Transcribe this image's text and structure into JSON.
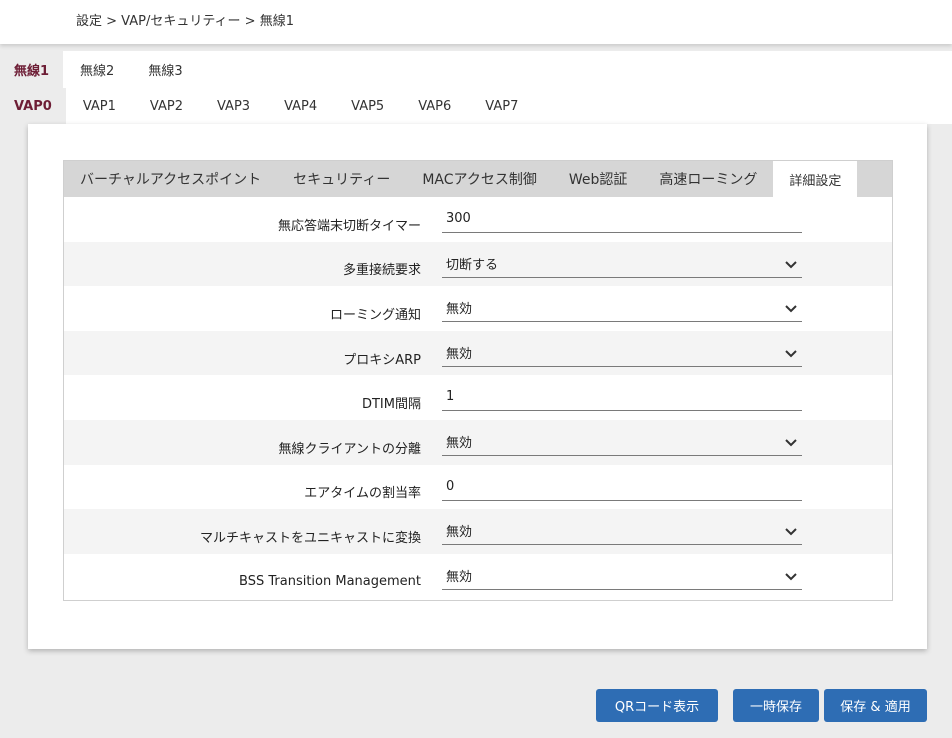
{
  "breadcrumb": "設定 > VAP/セキュリティー > 無線1",
  "radio_tabs": [
    "無線1",
    "無線2",
    "無線3"
  ],
  "radio_active": 0,
  "vap_tabs": [
    "VAP0",
    "VAP1",
    "VAP2",
    "VAP3",
    "VAP4",
    "VAP5",
    "VAP6",
    "VAP7"
  ],
  "vap_active": 0,
  "sub_tabs": [
    "バーチャルアクセスポイント",
    "セキュリティー",
    "MACアクセス制御",
    "Web認証",
    "高速ローミング",
    "詳細設定"
  ],
  "sub_active": 5,
  "rows": [
    {
      "label": "無応答端末切断タイマー",
      "value": "300",
      "kind": "text"
    },
    {
      "label": "多重接続要求",
      "value": "切断する",
      "kind": "select"
    },
    {
      "label": "ローミング通知",
      "value": "無効",
      "kind": "select"
    },
    {
      "label": "プロキシARP",
      "value": "無効",
      "kind": "select"
    },
    {
      "label": "DTIM間隔",
      "value": "1",
      "kind": "text"
    },
    {
      "label": "無線クライアントの分離",
      "value": "無効",
      "kind": "select"
    },
    {
      "label": "エアタイムの割当率",
      "value": "0",
      "kind": "text"
    },
    {
      "label": "マルチキャストをユニキャストに変換",
      "value": "無効",
      "kind": "select"
    },
    {
      "label": "BSS Transition Management",
      "value": "無効",
      "kind": "select"
    }
  ],
  "buttons": {
    "qr": "QRコード表示",
    "temp_save": "一時保存",
    "save_apply": "保存 & 適用"
  },
  "colors": {
    "accent": "#6d1d35",
    "button": "#2e6db4"
  }
}
